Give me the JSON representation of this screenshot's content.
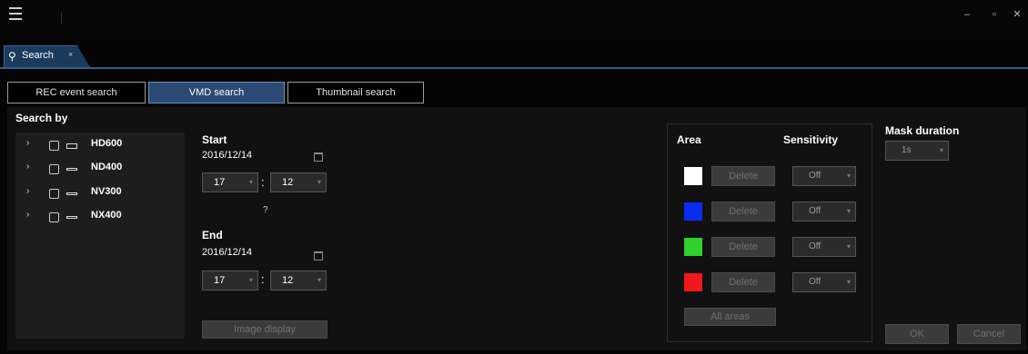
{
  "tab": {
    "icon": "search-icon",
    "label": "Search",
    "close": "×"
  },
  "search_types": [
    "REC event search",
    "VMD search",
    "Thumbnail search"
  ],
  "search_by_label": "Search by",
  "devices": [
    {
      "name": "HD600",
      "icon": "camera-device-icon"
    },
    {
      "name": "ND400",
      "icon": "recorder-device-icon"
    },
    {
      "name": "NV300",
      "icon": "recorder-device-icon"
    },
    {
      "name": "NX400",
      "icon": "recorder-device-icon"
    }
  ],
  "start": {
    "label": "Start",
    "date": "2016/12/14",
    "hour": "17",
    "minute": "12"
  },
  "range_sep": "?",
  "end": {
    "label": "End",
    "date": "2016/12/14",
    "hour": "17",
    "minute": "12"
  },
  "image_display": "Image display",
  "area": {
    "label": "Area",
    "sensitivity_label": "Sensitivity",
    "rows": [
      {
        "color": "#ffffff",
        "delete": "Delete",
        "sensitivity": "Off"
      },
      {
        "color": "#0a2cf0",
        "delete": "Delete",
        "sensitivity": "Off"
      },
      {
        "color": "#2fd12c",
        "delete": "Delete",
        "sensitivity": "Off"
      },
      {
        "color": "#f01818",
        "delete": "Delete",
        "sensitivity": "Off"
      }
    ],
    "all_areas": "All areas"
  },
  "mask_duration": {
    "label": "Mask duration",
    "value": "1s"
  },
  "ok": "OK",
  "cancel": "Cancel",
  "colors": {
    "accent": "#2d5f95",
    "tab_bg": "#1c3a5c",
    "active_button": "#2a4a73"
  }
}
